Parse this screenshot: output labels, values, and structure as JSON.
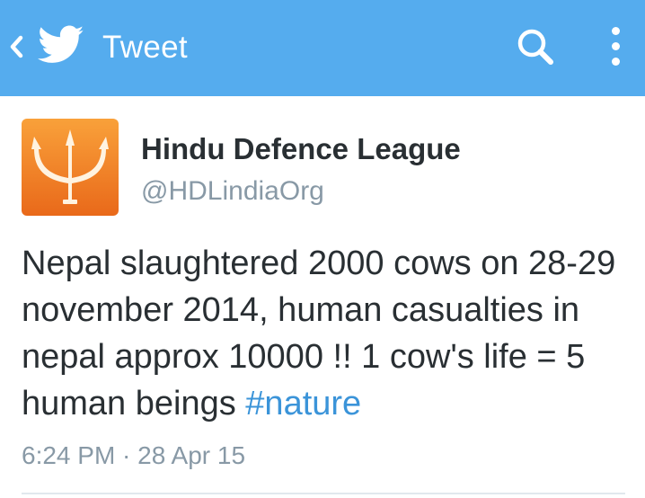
{
  "header": {
    "title": "Tweet",
    "back_icon": "chevron-left-icon",
    "logo_icon": "twitter-bird-icon",
    "search_icon": "search-icon",
    "more_icon": "more-vertical-icon",
    "background_color": "#55ACEE"
  },
  "tweet": {
    "author": {
      "name": "Hindu Defence League",
      "handle": "@HDLindiaOrg",
      "avatar_icon": "trident-icon",
      "avatar_color": "#F47B20"
    },
    "text": "Nepal slaughtered 2000 cows on 28-29 november 2014, human casualties in nepal approx 10000 !! 1 cow's life = 5 human beings ",
    "hashtag": "#nature",
    "hashtag_color": "#3B94D9",
    "timestamp": "6:24 PM · 28 Apr 15"
  }
}
